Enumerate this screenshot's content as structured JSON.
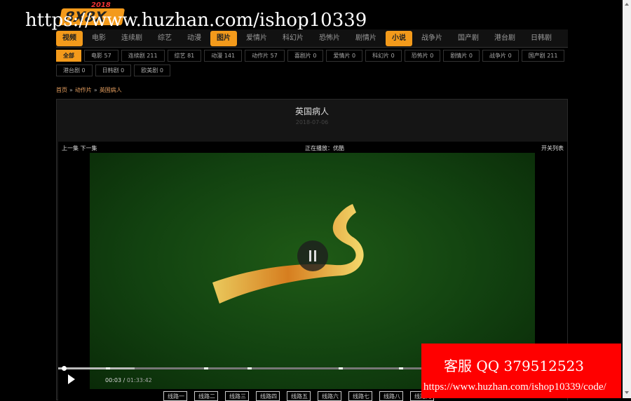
{
  "logo": {
    "text": "8X8X",
    "year": "2018"
  },
  "watermark": "https://www.huzhan.com/ishop10339",
  "nav": [
    {
      "label": "视频",
      "active": true
    },
    {
      "label": "电影"
    },
    {
      "label": "连续剧"
    },
    {
      "label": "综艺"
    },
    {
      "label": "动漫"
    },
    {
      "label": "图片",
      "active": true
    },
    {
      "label": "爱情片"
    },
    {
      "label": "科幻片"
    },
    {
      "label": "恐怖片"
    },
    {
      "label": "剧情片"
    },
    {
      "label": "小说",
      "active": true
    },
    {
      "label": "战争片"
    },
    {
      "label": "国产剧"
    },
    {
      "label": "港台剧"
    },
    {
      "label": "日韩剧"
    }
  ],
  "filters": [
    {
      "label": "全部",
      "active": true
    },
    {
      "label": "电影 57"
    },
    {
      "label": "连续剧 211"
    },
    {
      "label": "综艺 81"
    },
    {
      "label": "动漫 141"
    },
    {
      "label": "动作片 57"
    },
    {
      "label": "喜剧片 0"
    },
    {
      "label": "爱情片 0"
    },
    {
      "label": "科幻片 0"
    },
    {
      "label": "恐怖片 0"
    },
    {
      "label": "剧情片 0"
    },
    {
      "label": "战争片 0"
    },
    {
      "label": "国产剧 211"
    },
    {
      "label": "港台剧 0"
    },
    {
      "label": "日韩剧 0"
    },
    {
      "label": "欧美剧 0"
    }
  ],
  "breadcrumb": [
    "首页",
    "动作片",
    "英国病人"
  ],
  "breadcrumb_sep": "»",
  "title": "英国病人",
  "date": "2018-07-06",
  "player": {
    "prev_next": "上一集 下一集",
    "now_playing": "正在播放：优酷",
    "toggle_list": "开关列表",
    "current_time": "00:03",
    "duration": "01:33:42",
    "time_sep": " / ",
    "progress_fraction": 0.0006,
    "buffered_fraction": 0.15
  },
  "lines": [
    "线路一",
    "线路二",
    "线路三",
    "线路四",
    "线路五",
    "线路六",
    "线路七",
    "线路八",
    "线路九"
  ],
  "ad": {
    "line1": "客服 QQ 379512523",
    "line2": "https://www.huzhan.com/ishop10339/code/"
  },
  "colors": {
    "accent": "#f39a1b",
    "ad": "#ff0000"
  }
}
